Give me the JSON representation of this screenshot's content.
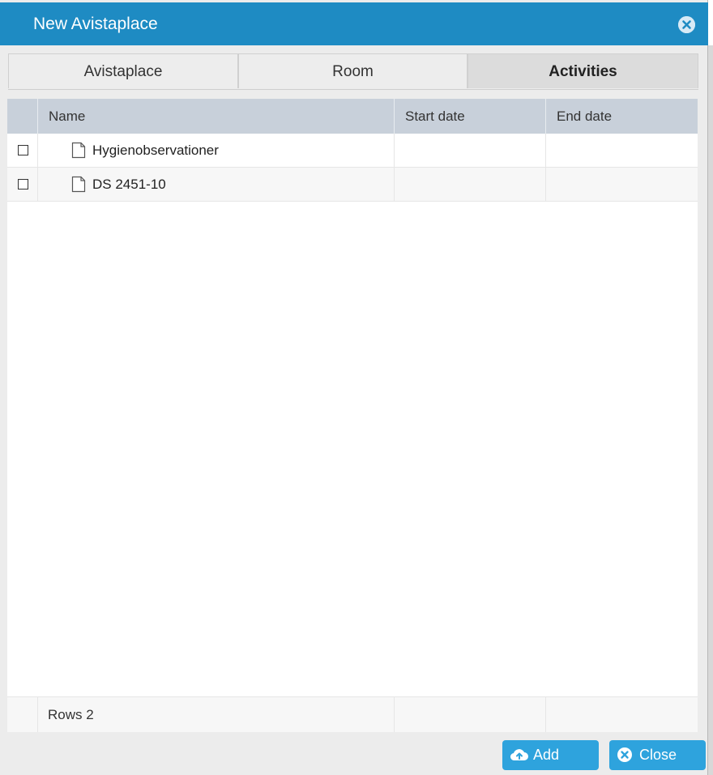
{
  "dialog": {
    "title": "New Avistaplace"
  },
  "tabs": [
    {
      "label": "Avistaplace"
    },
    {
      "label": "Room"
    },
    {
      "label": "Activities"
    }
  ],
  "grid": {
    "columns": [
      "Name",
      "Start date",
      "End date"
    ],
    "rows": [
      {
        "name": "Hygienobservationer",
        "start_date": "",
        "end_date": ""
      },
      {
        "name": "DS 2451-10",
        "start_date": "",
        "end_date": ""
      }
    ],
    "footer": "Rows 2"
  },
  "buttons": {
    "add": "Add",
    "close": "Close"
  },
  "colors": {
    "titlebar": "#1e8bc3",
    "header": "#c8d0da",
    "button": "#2ea3dd"
  },
  "icons": {
    "close": "close-circle-icon",
    "document": "document-icon",
    "upload": "cloud-upload-icon",
    "cancel": "cancel-circle-icon"
  }
}
